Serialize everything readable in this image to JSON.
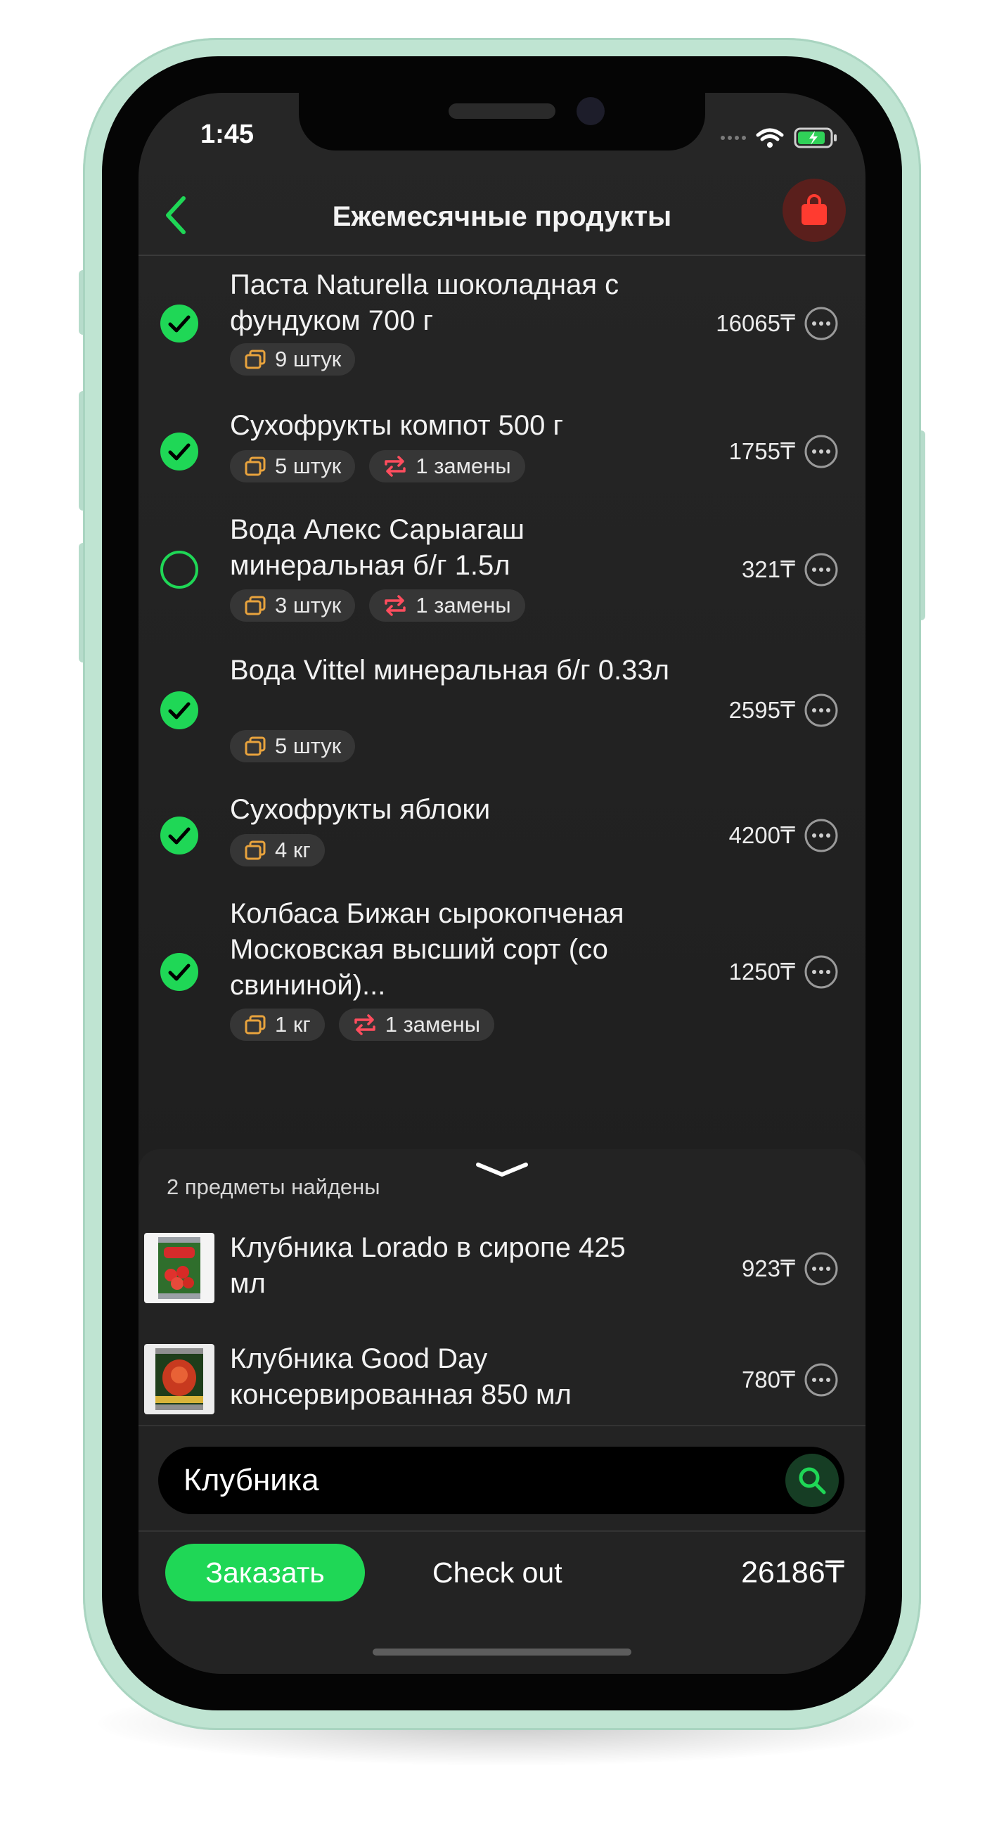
{
  "status_bar": {
    "time": "1:45"
  },
  "nav": {
    "title": "Ежемесячные продукты"
  },
  "items": [
    {
      "name": "Паста Naturella шоколадная с фундуком 700 г",
      "price": "16065₸",
      "checked": true,
      "quantity": "9 штук",
      "replacements": null
    },
    {
      "name": "Сухофрукты компот 500 г",
      "price": "1755₸",
      "checked": true,
      "quantity": "5 штук",
      "replacements": "1 замены"
    },
    {
      "name": "Вода Алекс Сарыагаш минеральная б/г 1.5л",
      "price": "321₸",
      "checked": false,
      "quantity": "3 штук",
      "replacements": "1 замены"
    },
    {
      "name": "Вода Vittel минеральная б/г 0.33л",
      "price": "2595₸",
      "checked": true,
      "quantity": "5 штук",
      "replacements": null
    },
    {
      "name": "Сухофрукты яблоки",
      "price": "4200₸",
      "checked": true,
      "quantity": "4 кг",
      "replacements": null
    },
    {
      "name": "Колбаса Бижан сырокопченая Московская высший сорт (со свининой)...",
      "price": "1250₸",
      "checked": true,
      "quantity": "1 кг",
      "replacements": "1 замены"
    }
  ],
  "results": {
    "found_label": "2 предметы найдены",
    "items": [
      {
        "name": "Клубника Lorado в сиропе 425 мл",
        "price": "923₸"
      },
      {
        "name": "Клубника Good Day консервированная 850 мл",
        "price": "780₸"
      }
    ]
  },
  "search": {
    "value": "Клубника"
  },
  "footer": {
    "order_label": "Заказать",
    "checkout_label": "Check out",
    "total": "26186₸"
  },
  "colors": {
    "accent": "#1fd756",
    "tag_icon": "#e8a33d",
    "swap_icon": "#ff4d5e",
    "bag": "#ff3b30",
    "frame": "#bfe4d2"
  },
  "icons": {
    "back": "chevron-left-icon",
    "bag": "shopping-bag-icon",
    "check": "check-circle-icon",
    "more": "ellipsis-circle-icon",
    "quantity": "stack-icon",
    "replace": "swap-icon",
    "search": "search-icon",
    "collapse": "chevron-down-icon"
  }
}
